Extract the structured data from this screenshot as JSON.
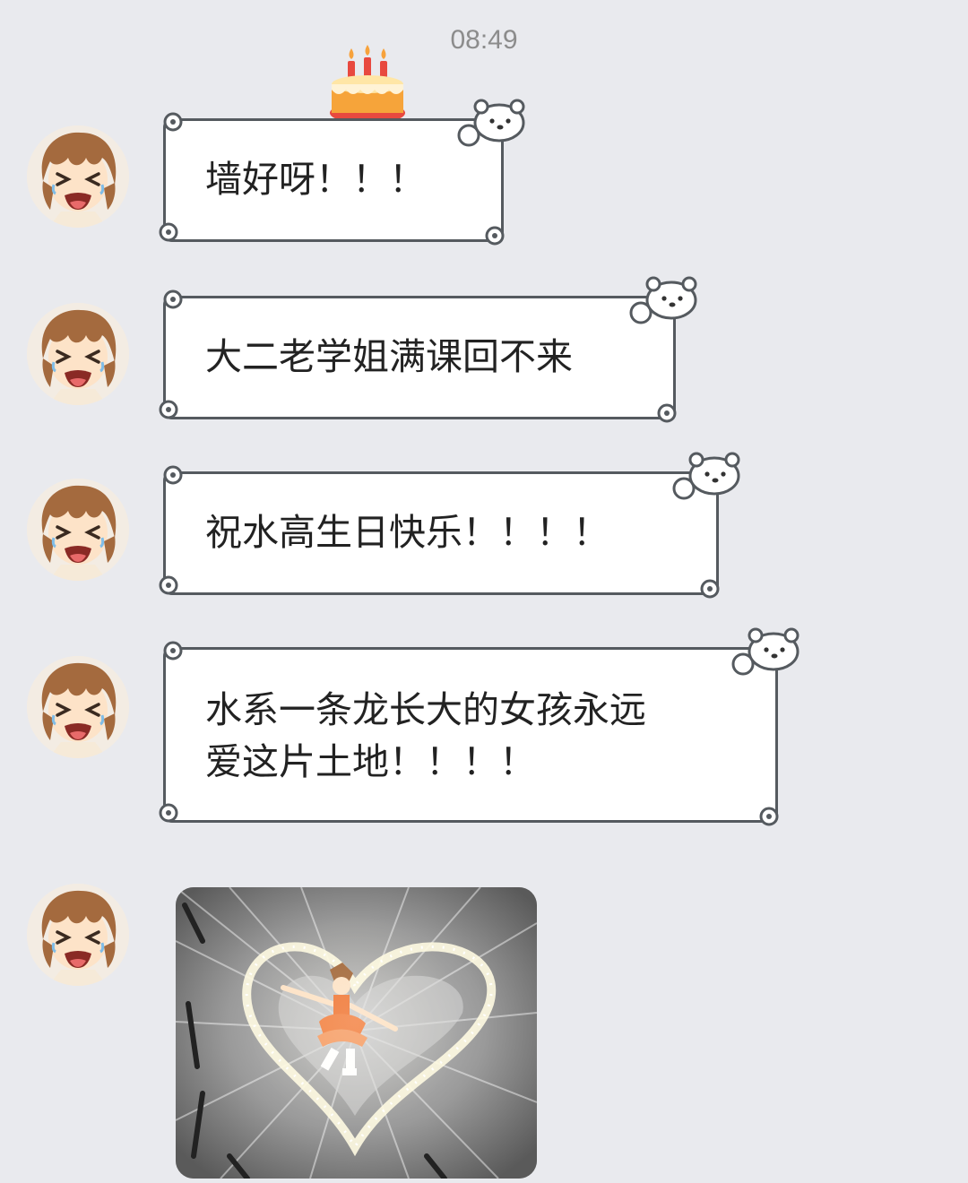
{
  "status": {
    "time": "08:49"
  },
  "sticker": {
    "icon": "birthday-cake-icon"
  },
  "messages": [
    {
      "text": "墙好呀！！！"
    },
    {
      "text": "大二老学姐满课回不来"
    },
    {
      "text": "祝水高生日快乐！！！！"
    },
    {
      "text": "水系一条龙长大的女孩永远\n爱这片土地！！！！"
    }
  ],
  "image_message": {
    "icon": "dancing-girl-heart-sparkles-image"
  },
  "colors": {
    "background": "#e9eaee",
    "bubble_border": "#555a5f",
    "bubble_fill": "#ffffff",
    "avatar_hair": "#a46a3e"
  }
}
